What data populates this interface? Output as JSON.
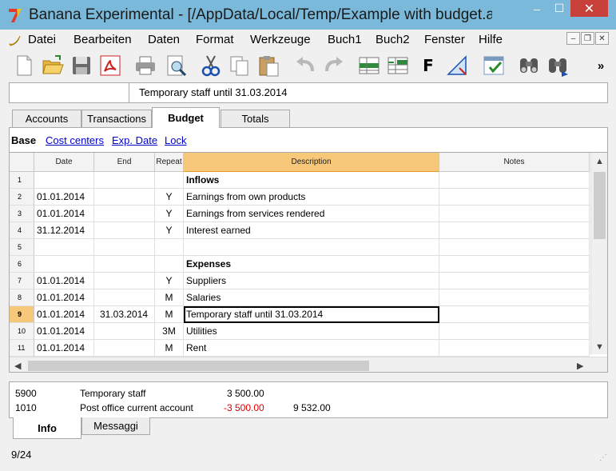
{
  "window": {
    "title": "Banana Experimental - [/AppData/Local/Temp/Example with budget.a…",
    "minimize": "–",
    "maximize": "☐",
    "close": "✕"
  },
  "menu": [
    "Datei",
    "Bearbeiten",
    "Daten",
    "Format",
    "Werkzeuge",
    "Buch1",
    "Buch2",
    "Fenster",
    "Hilfe"
  ],
  "mdi": {
    "minimize": "–",
    "restore": "❐",
    "close": "✕"
  },
  "toolbar": {
    "icons": [
      "new-document-icon",
      "open-folder-icon",
      "save-icon",
      "pdf-icon",
      "print-icon",
      "print-preview-icon",
      "cut-icon",
      "copy-icon",
      "paste-icon",
      "undo-icon",
      "redo-icon",
      "insert-row-icon",
      "add-rows-icon",
      "format-bold-icon",
      "check-accounting-icon",
      "recheck-icon",
      "find-icon",
      "find-next-icon"
    ],
    "bold_label": "F",
    "overflow_label": "»"
  },
  "cell_bar": {
    "content": "Temporary staff until 31.03.2014"
  },
  "tabs": [
    "Accounts",
    "Transactions",
    "Budget",
    "Totals"
  ],
  "views": {
    "current": "Base",
    "links": [
      "Cost centers",
      "Exp. Date",
      "Lock"
    ]
  },
  "table": {
    "headers": [
      "Date",
      "End",
      "Repeat",
      "Description",
      "Notes"
    ],
    "rows": [
      {
        "n": "1",
        "date": "",
        "end": "",
        "repeat": "",
        "desc": "Inflows",
        "bold": true
      },
      {
        "n": "2",
        "date": "01.01.2014",
        "end": "",
        "repeat": "Y",
        "desc": "Earnings from own products"
      },
      {
        "n": "3",
        "date": "01.01.2014",
        "end": "",
        "repeat": "Y",
        "desc": "Earnings from services rendered"
      },
      {
        "n": "4",
        "date": "31.12.2014",
        "end": "",
        "repeat": "Y",
        "desc": "Interest earned"
      },
      {
        "n": "5",
        "date": "",
        "end": "",
        "repeat": "",
        "desc": ""
      },
      {
        "n": "6",
        "date": "",
        "end": "",
        "repeat": "",
        "desc": "Expenses",
        "bold": true
      },
      {
        "n": "7",
        "date": "01.01.2014",
        "end": "",
        "repeat": "Y",
        "desc": "Suppliers"
      },
      {
        "n": "8",
        "date": "01.01.2014",
        "end": "",
        "repeat": "M",
        "desc": "Salaries"
      },
      {
        "n": "9",
        "date": "01.01.2014",
        "end": "31.03.2014",
        "repeat": "M",
        "desc": "Temporary staff until 31.03.2014",
        "selected": true
      },
      {
        "n": "10",
        "date": "01.01.2014",
        "end": "",
        "repeat": "3M",
        "desc": "Utilities"
      },
      {
        "n": "11",
        "date": "01.01.2014",
        "end": "",
        "repeat": "M",
        "desc": "Rent"
      }
    ]
  },
  "info": {
    "line1": {
      "account": "5900",
      "name": "Temporary staff",
      "amount": "3 500.00"
    },
    "line2": {
      "account": "1010",
      "name": "Post office current account",
      "amount": "-3 500.00",
      "balance": "9 532.00"
    }
  },
  "bottom_tabs": [
    "Info",
    "Messaggi"
  ],
  "status": "9/24",
  "colors": {
    "titlebar": "#7ab9d9",
    "selected_header": "#f7c77a",
    "close_button": "#c7403a",
    "negative": "#e00000",
    "link": "#0000cc"
  }
}
